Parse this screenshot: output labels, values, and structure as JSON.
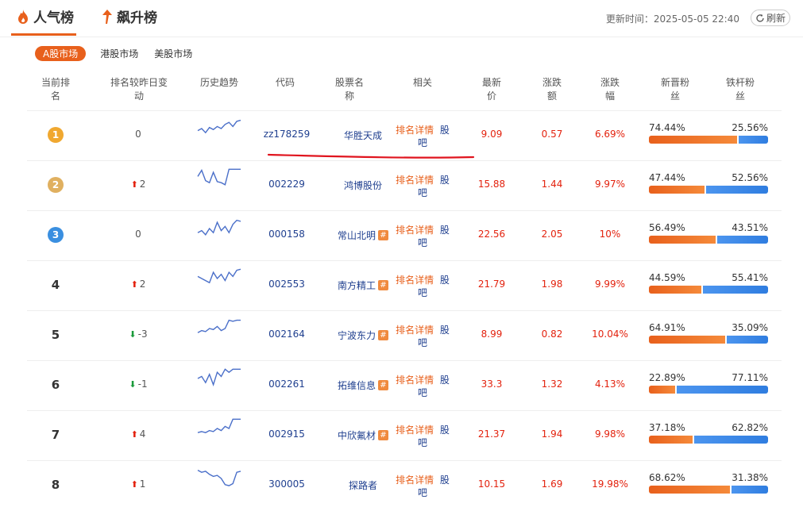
{
  "tabs": {
    "popular": "人气榜",
    "rising": "飙升榜"
  },
  "update_label": "更新时间：",
  "update_time": "2025-05-05 22:40",
  "refresh_label": "刷新",
  "markets": [
    "A股市场",
    "港股市场",
    "美股市场"
  ],
  "headers": {
    "rank": [
      "当前排",
      "名"
    ],
    "change": [
      "排名较昨日变",
      "动"
    ],
    "trend": [
      "历史趋势"
    ],
    "code": [
      "代码"
    ],
    "name": [
      "股票名",
      "称"
    ],
    "related": [
      "相关"
    ],
    "price": [
      "最新",
      "价"
    ],
    "amount": [
      "涨跌",
      "额"
    ],
    "percent": [
      "涨跌",
      "幅"
    ],
    "new_fans": [
      "新晋粉",
      "丝"
    ],
    "loyal_fans": [
      "铁杆粉",
      "丝"
    ]
  },
  "related_links": {
    "detail": "排名详情",
    "guba_1": "股",
    "guba_2": "吧"
  },
  "colors": {
    "accent": "#e8601c",
    "up": "#e3220e",
    "down": "#1a9a3a",
    "link": "#1f3f8f",
    "gold": "#f0a830",
    "silver": "#e0b060",
    "bronze": "#3a8fe0"
  },
  "rows": [
    {
      "rank": "1",
      "change": "0",
      "dir": "none",
      "code": "zz178259",
      "name": "华胜天成",
      "hot": false,
      "price": "9.09",
      "amount": "0.57",
      "percent": "6.69%",
      "new_fans": "74.44%",
      "loyal_fans": "25.56%",
      "new_frac": 0.7444,
      "trend": [
        0.4,
        0.5,
        0.3,
        0.55,
        0.45,
        0.6,
        0.5,
        0.7,
        0.8,
        0.6,
        0.85,
        0.9
      ]
    },
    {
      "rank": "2",
      "change": "2",
      "dir": "up",
      "code": "002229",
      "name": "鸿博股份",
      "hot": false,
      "price": "15.88",
      "amount": "1.44",
      "percent": "9.97%",
      "new_fans": "47.44%",
      "loyal_fans": "52.56%",
      "new_frac": 0.4744,
      "trend": [
        0.6,
        0.9,
        0.4,
        0.3,
        0.8,
        0.35,
        0.3,
        0.2,
        0.95,
        0.95,
        0.95,
        0.95
      ]
    },
    {
      "rank": "3",
      "change": "0",
      "dir": "none",
      "code": "000158",
      "name": "常山北明",
      "hot": true,
      "price": "22.56",
      "amount": "2.05",
      "percent": "10%",
      "new_fans": "56.49%",
      "loyal_fans": "43.51%",
      "new_frac": 0.5649,
      "trend": [
        0.3,
        0.4,
        0.2,
        0.5,
        0.3,
        0.8,
        0.4,
        0.6,
        0.3,
        0.7,
        0.9,
        0.85
      ]
    },
    {
      "rank": "4",
      "change": "2",
      "dir": "up",
      "code": "002553",
      "name": "南方精工",
      "hot": true,
      "price": "21.79",
      "amount": "1.98",
      "percent": "9.99%",
      "new_fans": "44.59%",
      "loyal_fans": "55.41%",
      "new_frac": 0.4459,
      "trend": [
        0.6,
        0.5,
        0.4,
        0.3,
        0.8,
        0.5,
        0.7,
        0.4,
        0.8,
        0.6,
        0.9,
        0.95
      ]
    },
    {
      "rank": "5",
      "change": "-3",
      "dir": "down",
      "code": "002164",
      "name": "宁波东力",
      "hot": true,
      "price": "8.99",
      "amount": "0.82",
      "percent": "10.04%",
      "new_fans": "64.91%",
      "loyal_fans": "35.09%",
      "new_frac": 0.6491,
      "trend": [
        0.3,
        0.4,
        0.35,
        0.5,
        0.45,
        0.6,
        0.4,
        0.5,
        0.9,
        0.85,
        0.9,
        0.9
      ]
    },
    {
      "rank": "6",
      "change": "-1",
      "dir": "down",
      "code": "002261",
      "name": "拓维信息",
      "hot": true,
      "price": "33.3",
      "amount": "1.32",
      "percent": "4.13%",
      "new_fans": "22.89%",
      "loyal_fans": "77.11%",
      "new_frac": 0.2289,
      "trend": [
        0.5,
        0.6,
        0.3,
        0.7,
        0.2,
        0.8,
        0.6,
        0.95,
        0.8,
        0.95,
        0.95,
        0.95
      ]
    },
    {
      "rank": "7",
      "change": "4",
      "dir": "up",
      "code": "002915",
      "name": "中欣氟材",
      "hot": true,
      "price": "21.37",
      "amount": "1.94",
      "percent": "9.98%",
      "new_fans": "37.18%",
      "loyal_fans": "62.82%",
      "new_frac": 0.3718,
      "trend": [
        0.3,
        0.35,
        0.3,
        0.4,
        0.35,
        0.5,
        0.4,
        0.6,
        0.5,
        0.95,
        0.95,
        0.95
      ]
    },
    {
      "rank": "8",
      "change": "1",
      "dir": "up",
      "code": "300005",
      "name": "探路者",
      "hot": false,
      "price": "10.15",
      "amount": "1.69",
      "percent": "19.98%",
      "new_fans": "68.62%",
      "loyal_fans": "31.38%",
      "new_frac": 0.6862,
      "trend": [
        0.9,
        0.8,
        0.85,
        0.7,
        0.6,
        0.65,
        0.5,
        0.2,
        0.15,
        0.25,
        0.8,
        0.85
      ]
    }
  ]
}
